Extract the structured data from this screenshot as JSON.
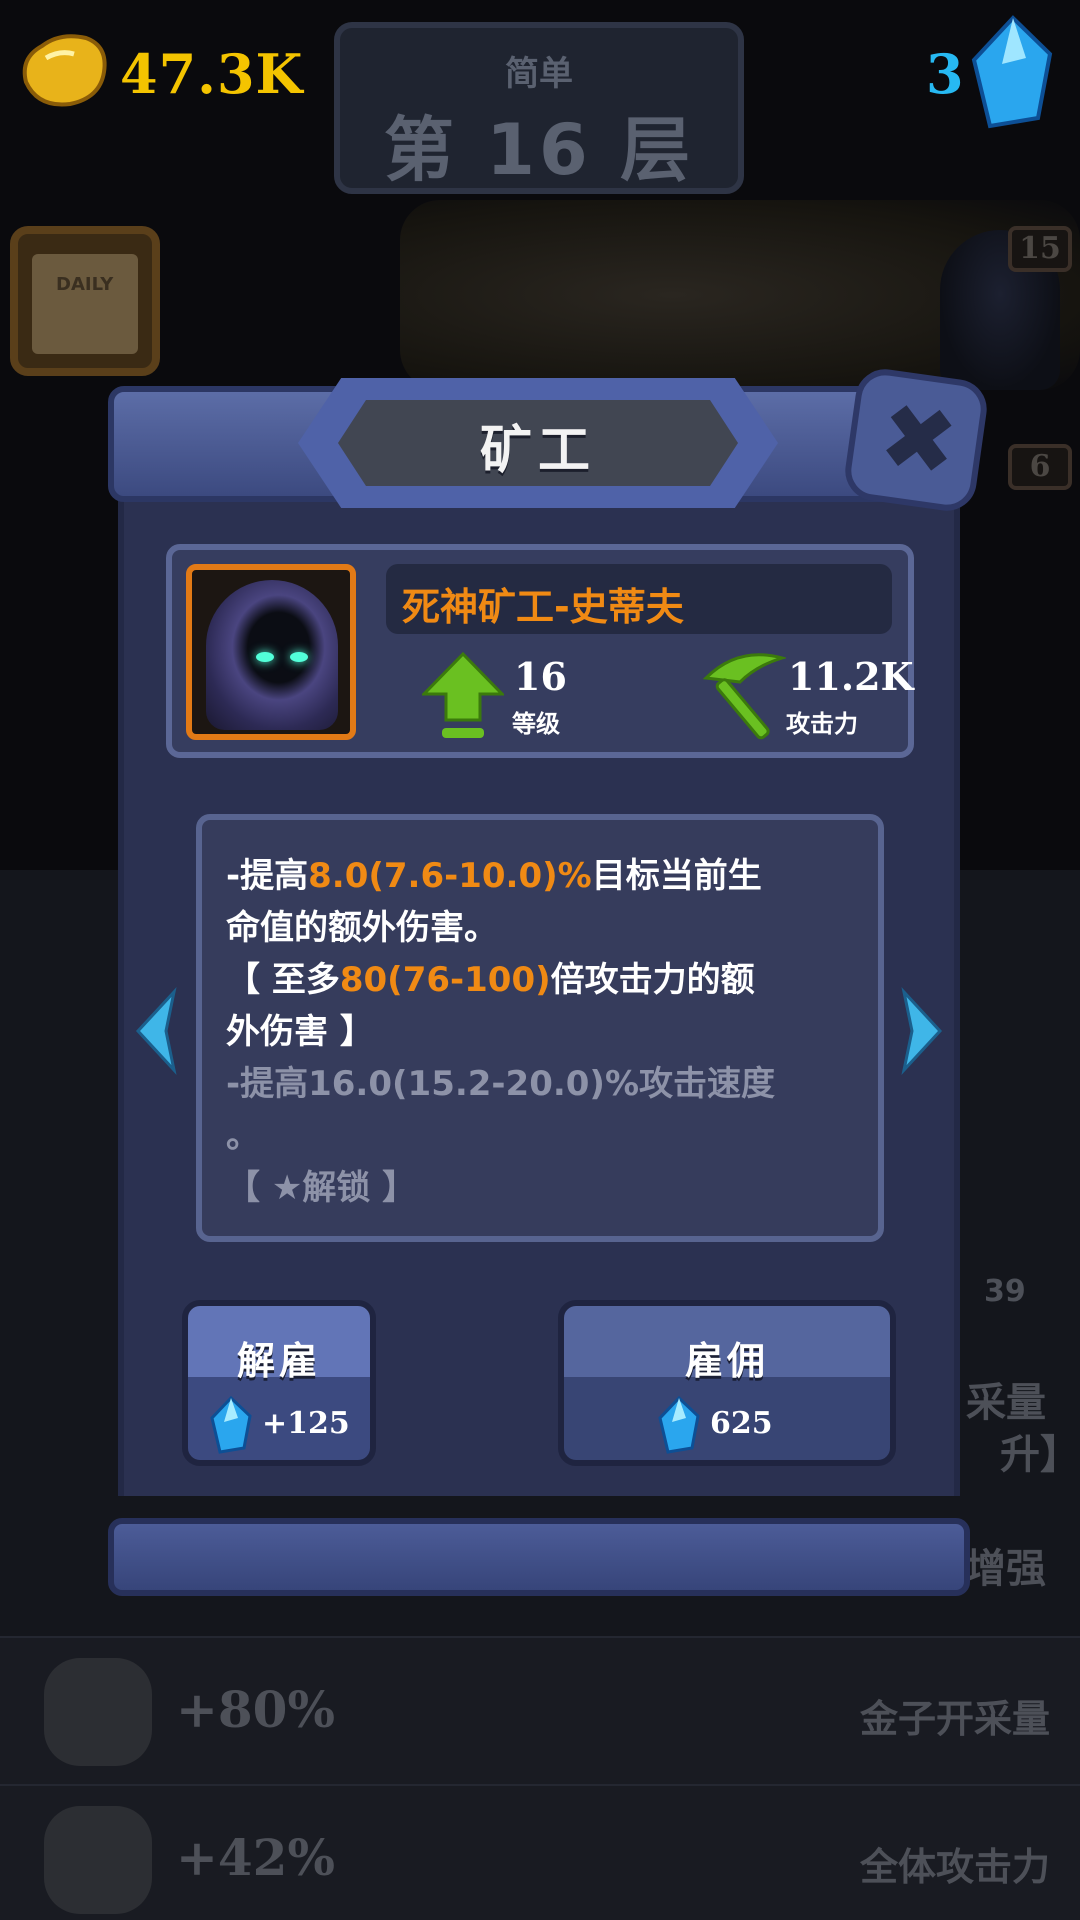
{
  "hud": {
    "gold": "47.3K",
    "gems": "3",
    "difficulty": "简单",
    "floor": "第 16 层",
    "daily_label": "DAILY",
    "bg_badge_top": "15",
    "bg_badge_bottom": "6"
  },
  "background_rows": [
    {
      "value": "+80%",
      "label": "金子开采量"
    },
    {
      "value": "+42%",
      "label": "全体攻击力"
    }
  ],
  "background_side": {
    "right_1": "采量",
    "right_2": "升】",
    "right_3": "增强",
    "count": "39"
  },
  "modal": {
    "title": "矿工",
    "character_name": "死神矿工-史蒂夫",
    "level_value": "16",
    "level_label": "等级",
    "attack_value": "11.2K",
    "attack_label": "攻击力",
    "description": {
      "l1a": "-提高",
      "l1b": "8.0(7.6-10.0)%",
      "l1c": "目标当前生",
      "l2": "命值的额外伤害。",
      "l3a": "【 至多",
      "l3b": "80(76-100)",
      "l3c": "倍攻击力的额",
      "l4": "外伤害 】",
      "l5": "-提高16.0(15.2-20.0)%攻击速度",
      "l6": "。",
      "l7": "【 ★解锁 】"
    },
    "fire_button": {
      "label": "解雇",
      "cost": "+125"
    },
    "hire_button": {
      "label": "雇佣",
      "cost": "625"
    }
  },
  "colors": {
    "gold": "#f4c400",
    "gem": "#27b9f2",
    "highlight": "#f08a14",
    "modal_bg": "#2b3151"
  }
}
